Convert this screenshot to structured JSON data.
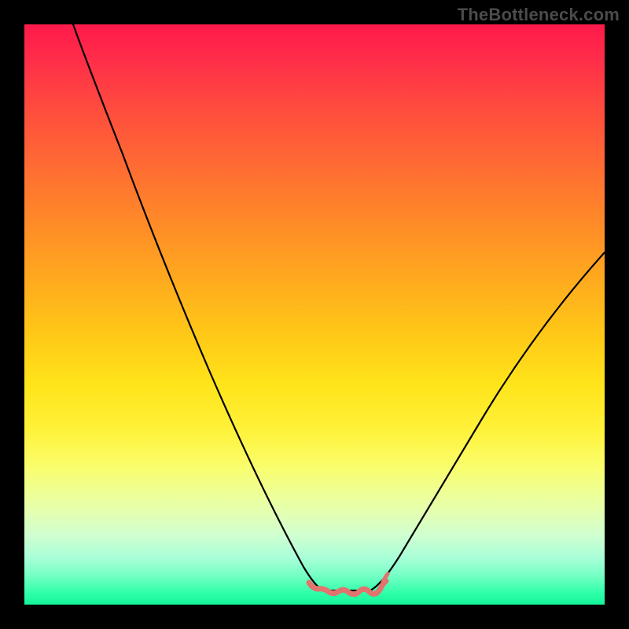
{
  "attribution": "TheBottleneck.com",
  "chart_data": {
    "type": "line",
    "title": "",
    "xlabel": "",
    "ylabel": "",
    "xlim": [
      0,
      100
    ],
    "ylim": [
      0,
      100
    ],
    "series": [
      {
        "name": "bottleneck-curve-left",
        "color": "#000000",
        "x": [
          10,
          15,
          20,
          25,
          30,
          35,
          40,
          45,
          50
        ],
        "values": [
          100,
          87,
          73,
          59,
          45,
          32,
          20,
          10,
          3
        ]
      },
      {
        "name": "bottleneck-curve-right",
        "color": "#000000",
        "x": [
          60,
          65,
          70,
          75,
          80,
          85,
          90,
          95,
          100
        ],
        "values": [
          3,
          8,
          16,
          24,
          32,
          40,
          47,
          54,
          61
        ]
      },
      {
        "name": "sweet-spot-band",
        "color": "#e2736d",
        "x": [
          50,
          52,
          54,
          56,
          58,
          60
        ],
        "values": [
          2.5,
          1.0,
          1.0,
          1.0,
          1.0,
          2.5
        ]
      }
    ],
    "background_gradient": {
      "stops": [
        {
          "pos": 0.0,
          "color": "#ff1a4b"
        },
        {
          "pos": 0.5,
          "color": "#ffca17"
        },
        {
          "pos": 0.8,
          "color": "#f0ff8f"
        },
        {
          "pos": 1.0,
          "color": "#14f59a"
        }
      ]
    }
  }
}
